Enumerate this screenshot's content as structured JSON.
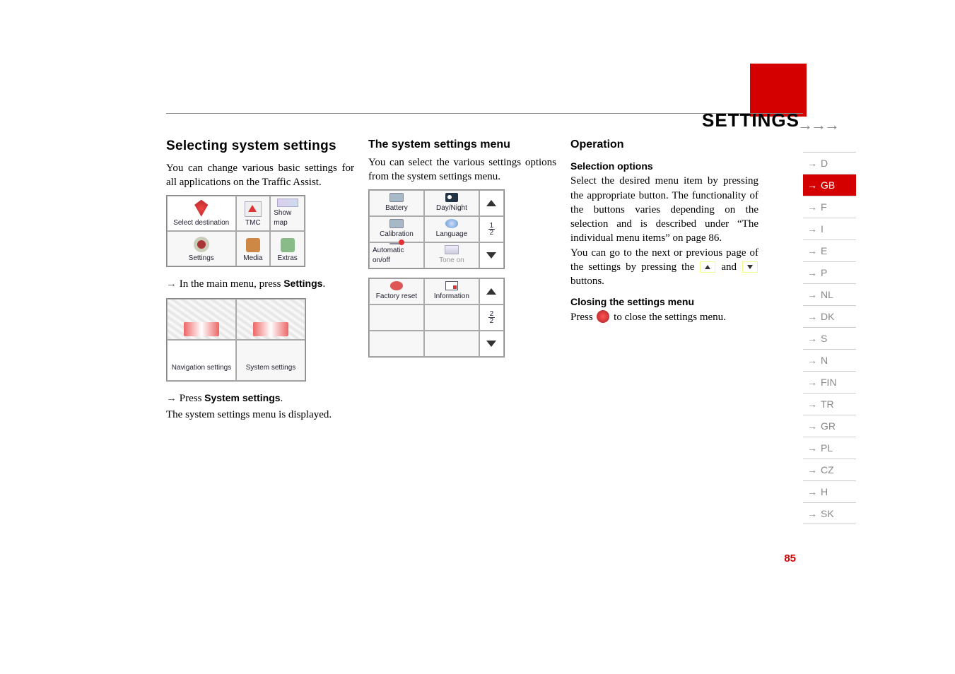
{
  "header": {
    "title": "SETTINGS",
    "arrow_marker": "→→→"
  },
  "col1": {
    "heading": "Selecting system settings",
    "para1": "You can change various basic settings for all applications on the Traffic Assist.",
    "mainmenu": {
      "select_destination": "Select destination",
      "tmc": "TMC",
      "show_map": "Show map",
      "settings": "Settings",
      "media": "Media",
      "extras": "Extras"
    },
    "step1_prefix": "In the main menu, press ",
    "step1_button": "Settings",
    "step1_suffix": ".",
    "tabs": {
      "navigation": "Navigation settings",
      "system": "System settings"
    },
    "step2_prefix": "Press ",
    "step2_button": "System settings",
    "step2_suffix": ".",
    "para2": "The system settings menu is displayed."
  },
  "col2": {
    "heading": "The system settings menu",
    "para1": "You can select the various settings options from the system settings menu.",
    "sysset": {
      "battery": "Battery",
      "daynight": "Day/Night",
      "calibration": "Calibration",
      "language": "Language",
      "auto": "Automatic on/off",
      "tone": "Tone on",
      "factory": "Factory reset",
      "information": "Information",
      "page1_top": "1",
      "page1_bot": "2",
      "page2_top": "2",
      "page2_bot": "2"
    }
  },
  "col3": {
    "heading": "Operation",
    "sub1": "Selection options",
    "para1a": "Select the desired menu item by pressing the appropriate button. The functionality of the buttons varies depending on the selection and is described under “The individual menu items” on page 86.",
    "para1b_pre": "You can go to the next or previous page of the settings by pressing the ",
    "para1b_mid": " and ",
    "para1b_post": " buttons.",
    "sub2": "Closing the settings menu",
    "para2_pre": "Press ",
    "para2_post": " to close the settings menu."
  },
  "languages": [
    "D",
    "GB",
    "F",
    "I",
    "E",
    "P",
    "NL",
    "DK",
    "S",
    "N",
    "FIN",
    "TR",
    "GR",
    "PL",
    "CZ",
    "H",
    "SK"
  ],
  "active_language_index": 1,
  "page_number": "85"
}
